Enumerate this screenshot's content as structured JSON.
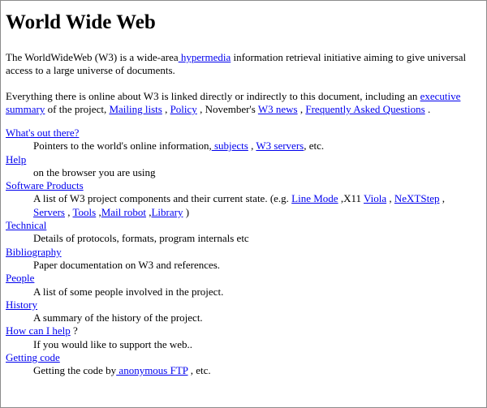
{
  "title": "World Wide Web",
  "intro": {
    "before_link": "The WorldWideWeb (W3) is a wide-area",
    "link": " hypermedia",
    "after_link": " information retrieval initiative aiming to give universal access to a large universe of documents."
  },
  "everything": {
    "text1": "Everything there is online about W3 is linked directly or indirectly to this document, including an ",
    "link_summary": "executive summary",
    "text2": " of the project, ",
    "link_mailing": "Mailing lists",
    "text3": " , ",
    "link_policy": "Policy",
    "text4": " , November's ",
    "link_news": "W3 news",
    "text5": " , ",
    "link_faq": "Frequently Asked Questions",
    "text6": " ."
  },
  "sections": {
    "whats_out": {
      "term": "What's out there?",
      "desc_text": "Pointers to the world's online information,",
      "link_subjects": " subjects",
      "sep1": " , ",
      "link_servers": "W3 servers",
      "desc_end": ", etc."
    },
    "help": {
      "term": "Help",
      "desc": "on the browser you are using"
    },
    "software": {
      "term": "Software Products",
      "desc_text": "A list of W3 project components and their current state. (e.g. ",
      "link_linemode": "Line Mode",
      "x11": " ,X11 ",
      "link_viola": "Viola",
      "sep_a": " , ",
      "link_nextstep": "NeXTStep",
      "sep_b": " ,",
      "link_servers": "Servers",
      "sep_c": " , ",
      "link_tools": "Tools",
      "sep_d": " ,",
      "link_mailrobot": "Mail robot",
      "sep_e": " ,",
      "link_library": "Library",
      "close": " )"
    },
    "technical": {
      "term": "Technical",
      "desc": "Details of protocols, formats, program internals etc"
    },
    "bibliography": {
      "term": "Bibliography",
      "desc": "Paper documentation on W3 and references."
    },
    "people": {
      "term": "People",
      "desc": "A list of some people involved in the project."
    },
    "history": {
      "term": "History",
      "desc": "A summary of the history of the project."
    },
    "howcanihelp": {
      "term": "How can I help",
      "term_suffix": " ?",
      "desc": "If you would like to support the web.."
    },
    "gettingcode": {
      "term": "Getting code",
      "desc_text": "Getting the code by",
      "link_ftp": " anonymous FTP",
      "desc_end": " , etc."
    }
  },
  "colors": {
    "link": "#0000ee",
    "text": "#000000",
    "background": "#ffffff",
    "border": "#8c8c8c"
  }
}
